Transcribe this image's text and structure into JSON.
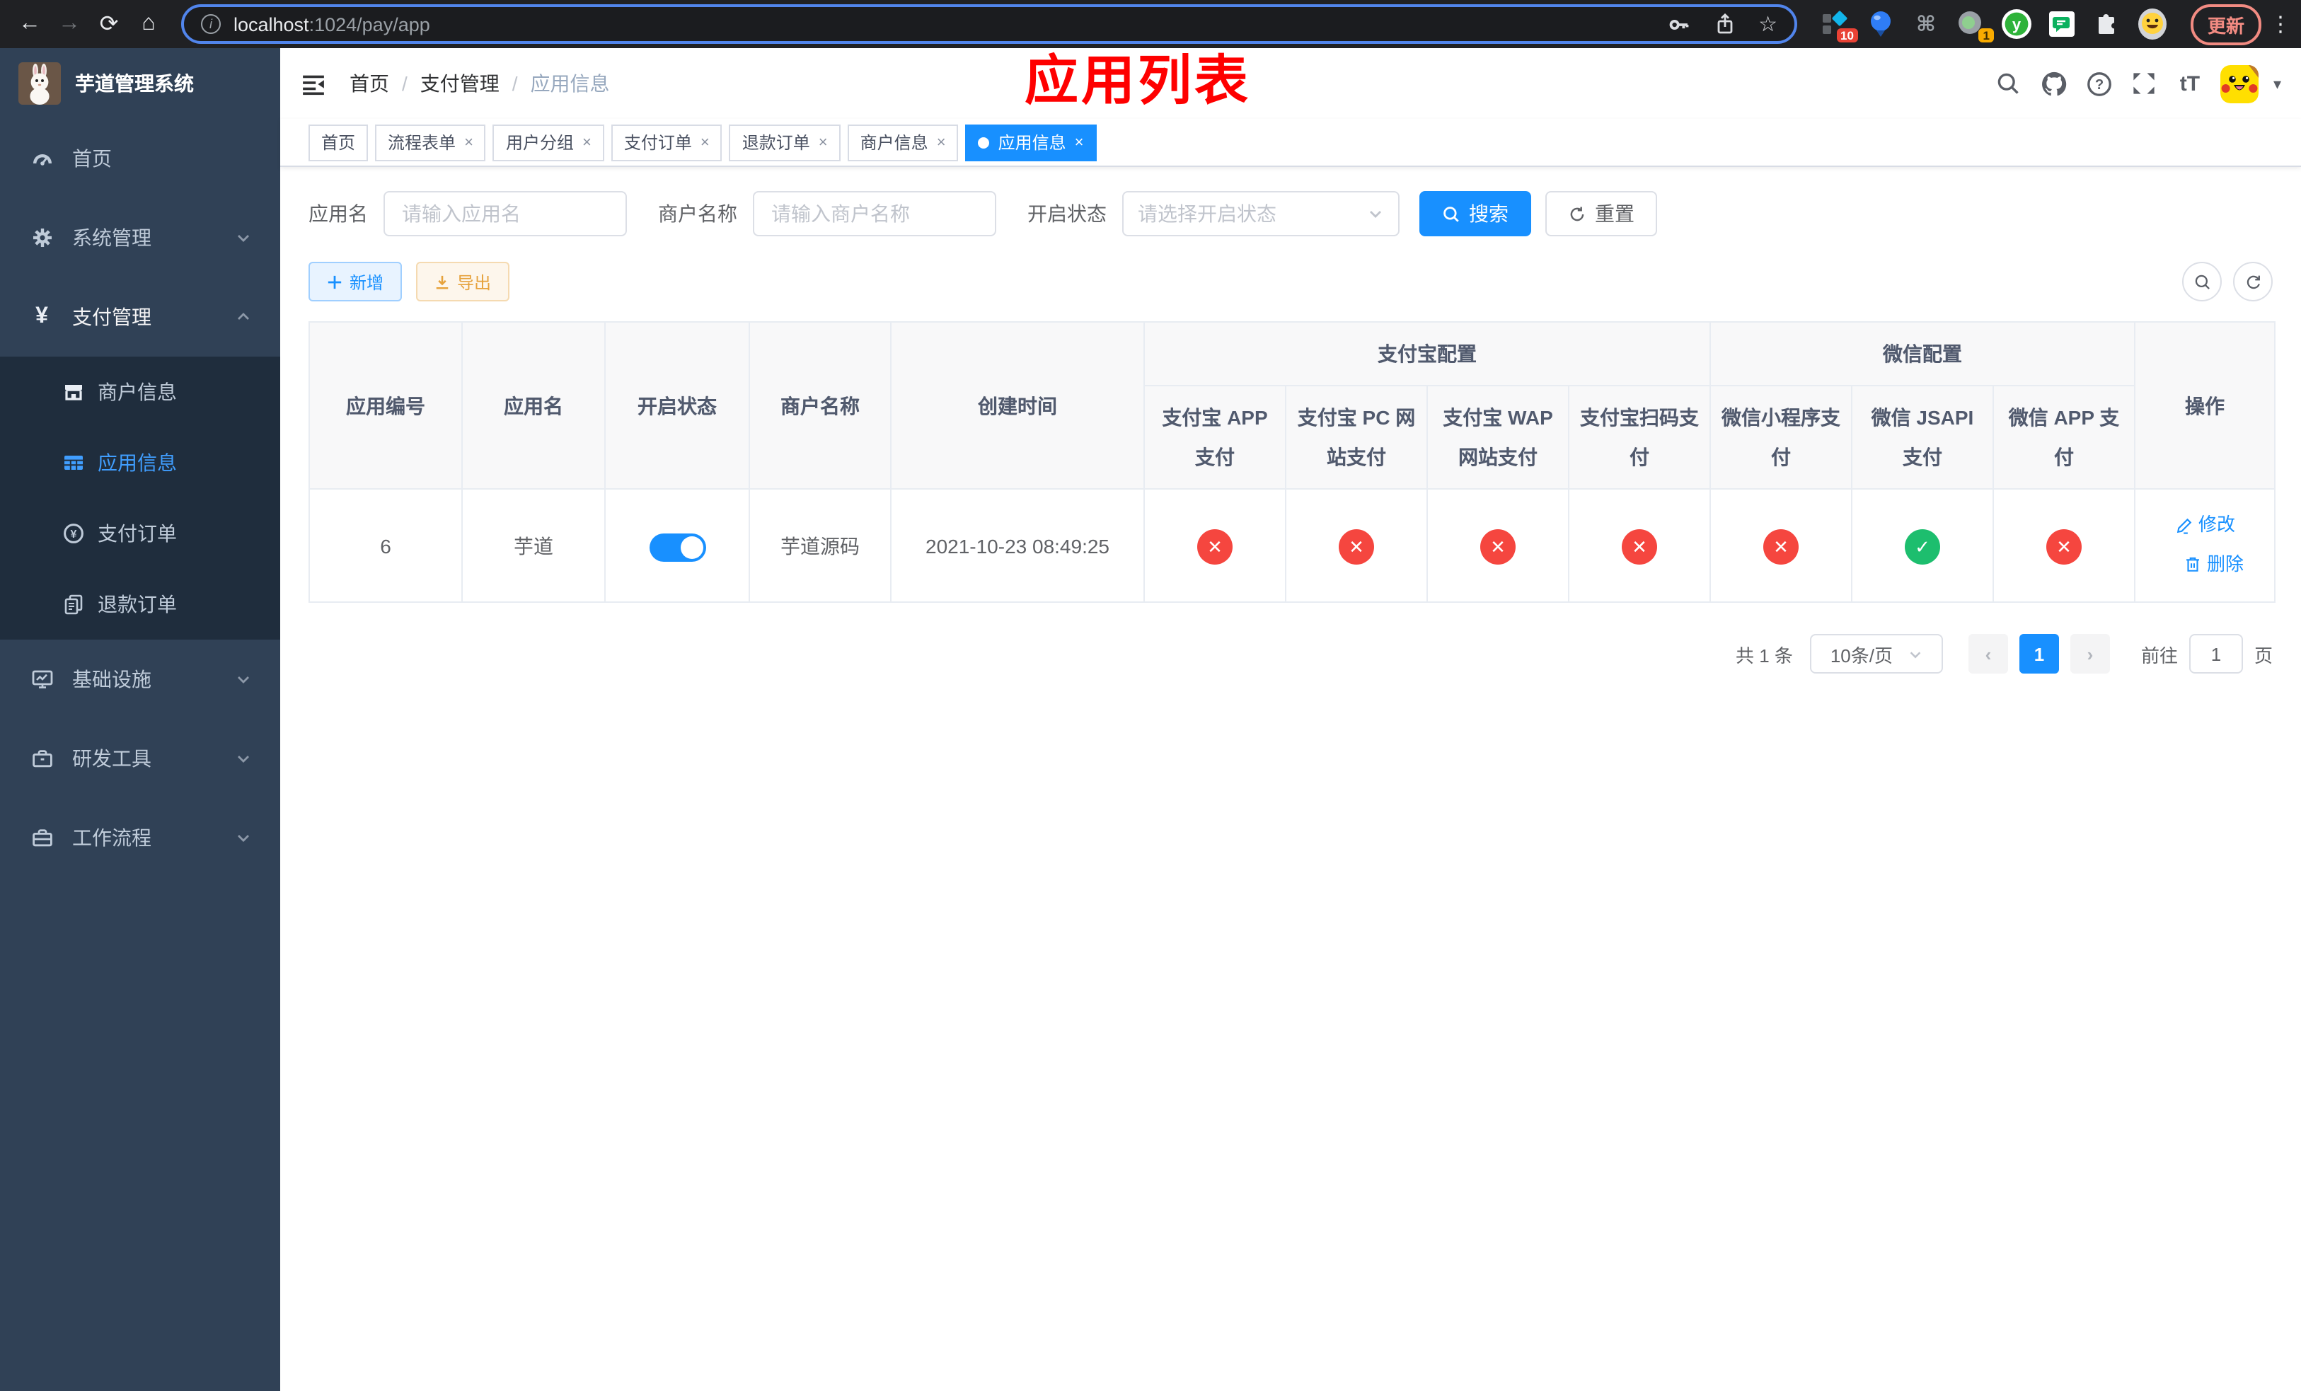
{
  "browser": {
    "url_host": "localhost",
    "url_path": ":1024/pay/app",
    "update_button": "更新",
    "ext_badge_pin": "10",
    "ext_badge_record": "1"
  },
  "icons": {
    "back": "←",
    "forward": "→",
    "reload": "⟳",
    "home": "⌂",
    "info": "i",
    "star": "☆",
    "command": "⌘",
    "kebab": "⋮",
    "caret_down": "▾",
    "yen": "¥",
    "font_size": "tT",
    "question": "?",
    "close": "×",
    "page_prev": "‹",
    "page_next": "›"
  },
  "sidebar": {
    "title": "芋道管理系统",
    "items": [
      {
        "label": "首页"
      },
      {
        "label": "系统管理"
      },
      {
        "label": "支付管理"
      },
      {
        "label": "商户信息"
      },
      {
        "label": "应用信息"
      },
      {
        "label": "支付订单"
      },
      {
        "label": "退款订单"
      },
      {
        "label": "基础设施"
      },
      {
        "label": "研发工具"
      },
      {
        "label": "工作流程"
      }
    ]
  },
  "header": {
    "breadcrumb": [
      "首页",
      "支付管理",
      "应用信息"
    ],
    "separator": "/",
    "annotation": "应用列表"
  },
  "tabs": [
    {
      "label": "首页",
      "closable": false,
      "active": false
    },
    {
      "label": "流程表单",
      "closable": true,
      "active": false
    },
    {
      "label": "用户分组",
      "closable": true,
      "active": false
    },
    {
      "label": "支付订单",
      "closable": true,
      "active": false
    },
    {
      "label": "退款订单",
      "closable": true,
      "active": false
    },
    {
      "label": "商户信息",
      "closable": true,
      "active": false
    },
    {
      "label": "应用信息",
      "closable": true,
      "active": true
    }
  ],
  "filters": {
    "app_name_label": "应用名",
    "app_name_placeholder": "请输入应用名",
    "merchant_label": "商户名称",
    "merchant_placeholder": "请输入商户名称",
    "status_label": "开启状态",
    "status_placeholder": "请选择开启状态",
    "search_button": "搜索",
    "reset_button": "重置"
  },
  "toolbar": {
    "add_button": "新增",
    "export_button": "导出"
  },
  "table": {
    "col_app_id": "应用编号",
    "col_app_name": "应用名",
    "col_status": "开启状态",
    "col_merchant": "商户名称",
    "col_created": "创建时间",
    "col_actions": "操作",
    "group_alipay": "支付宝配置",
    "group_wechat": "微信配置",
    "sub_columns": [
      "支付宝 APP 支付",
      "支付宝 PC 网站支付",
      "支付宝 WAP 网站支付",
      "支付宝扫码支付",
      "微信小程序支付",
      "微信 JSAPI 支付",
      "微信 APP 支付"
    ],
    "row": {
      "app_id": "6",
      "app_name": "芋道",
      "status_enabled": true,
      "merchant": "芋道源码",
      "created": "2021-10-23 08:49:25",
      "pay_channels": [
        {
          "name": "支付宝 APP 支付",
          "enabled": false,
          "symbol": "✕"
        },
        {
          "name": "支付宝 PC 网站支付",
          "enabled": false,
          "symbol": "✕"
        },
        {
          "name": "支付宝 WAP 网站支付",
          "enabled": false,
          "symbol": "✕"
        },
        {
          "name": "支付宝扫码支付",
          "enabled": false,
          "symbol": "✕"
        },
        {
          "name": "微信小程序支付",
          "enabled": false,
          "symbol": "✕"
        },
        {
          "name": "微信 JSAPI 支付",
          "enabled": true,
          "symbol": "✓"
        },
        {
          "name": "微信 APP 支付",
          "enabled": false,
          "symbol": "✕"
        }
      ],
      "edit_link": "修改",
      "delete_link": "删除"
    }
  },
  "pagination": {
    "total": "共 1 条",
    "page_size": "10条/页",
    "current_page": "1",
    "goto_label": "前往",
    "goto_value": "1",
    "unit_label": "页"
  },
  "colors": {
    "primary": "#1890ff",
    "sidebar_active": "#409eff",
    "danger": "#f5463f",
    "success": "#1dbe6e",
    "annotation_red": "#fe0000"
  }
}
